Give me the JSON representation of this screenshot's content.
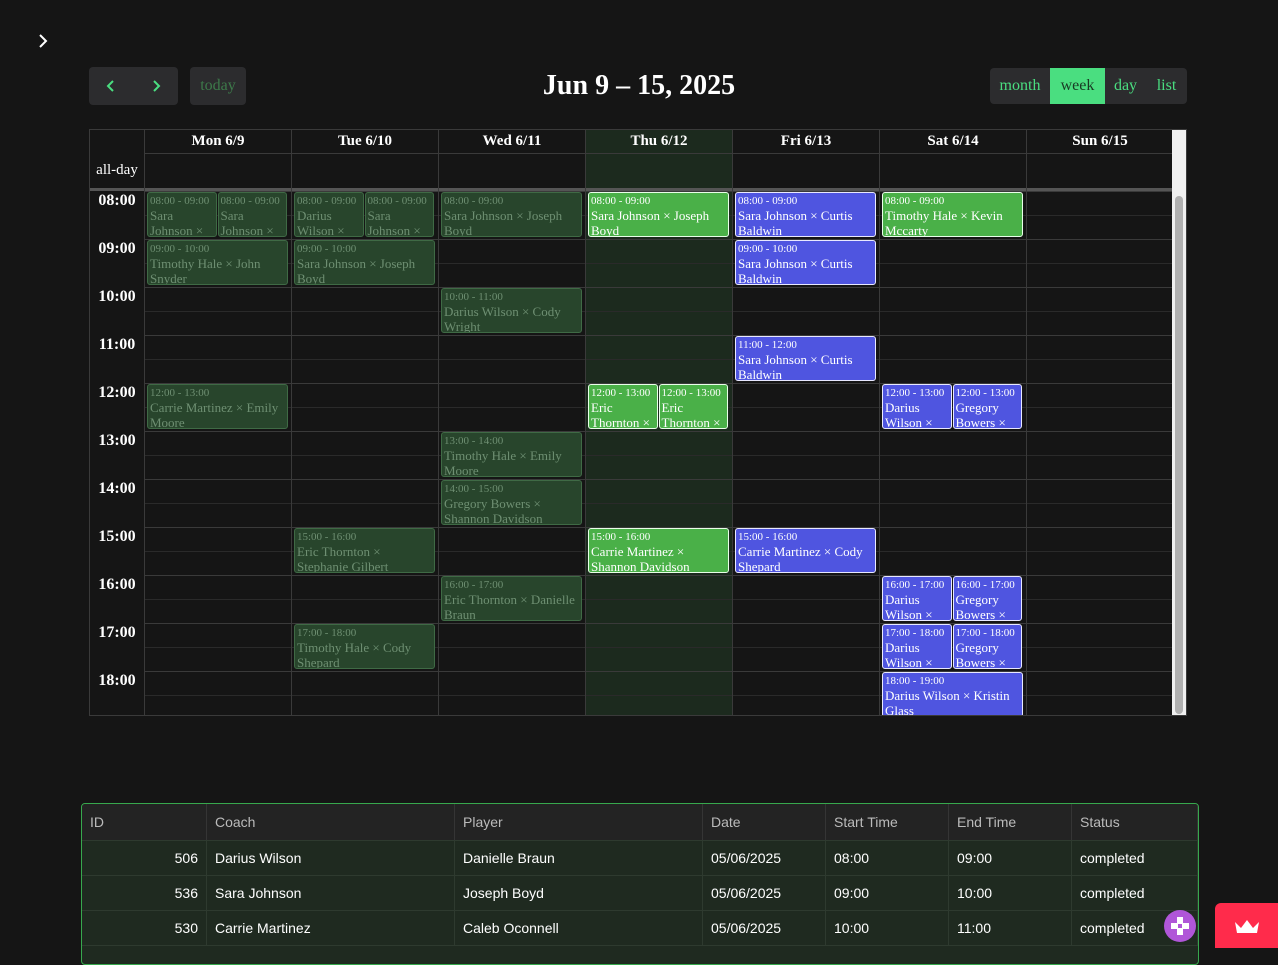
{
  "sidebar": {
    "expand_icon": "chevron-right-icon"
  },
  "toolbar": {
    "prev_icon": "chevron-left-icon",
    "next_icon": "chevron-right-icon",
    "today_label": "today",
    "title": "Jun 9 – 15, 2025",
    "views": [
      "month",
      "week",
      "day",
      "list"
    ],
    "active_view": "week"
  },
  "calendar": {
    "days": [
      "Mon 6/9",
      "Tue 6/10",
      "Wed 6/11",
      "Thu 6/12",
      "Fri 6/13",
      "Sat 6/14",
      "Sun 6/15"
    ],
    "today_index": 3,
    "allday_label": "all-day",
    "hours": [
      "08:00",
      "09:00",
      "10:00",
      "11:00",
      "12:00",
      "13:00",
      "14:00",
      "15:00",
      "16:00",
      "17:00",
      "18:00"
    ],
    "events": [
      {
        "day": 0,
        "start": 8,
        "end": 9,
        "col": 0,
        "cols": 2,
        "style": "past",
        "time": "08:00 - 09:00",
        "title": "Sara Johnson × Darius Wilson"
      },
      {
        "day": 0,
        "start": 8,
        "end": 9,
        "col": 1,
        "cols": 2,
        "style": "past",
        "time": "08:00 - 09:00",
        "title": "Sara Johnson × Kevin Mccarty"
      },
      {
        "day": 0,
        "start": 9,
        "end": 10,
        "col": 0,
        "cols": 1,
        "style": "past",
        "time": "09:00 - 10:00",
        "title": "Timothy Hale × John Snyder"
      },
      {
        "day": 0,
        "start": 12,
        "end": 13,
        "col": 0,
        "cols": 1,
        "style": "past",
        "time": "12:00 - 13:00",
        "title": "Carrie Martinez × Emily Moore"
      },
      {
        "day": 1,
        "start": 8,
        "end": 9,
        "col": 0,
        "cols": 2,
        "style": "past",
        "time": "08:00 - 09:00",
        "title": "Darius Wilson × Kristin Glass"
      },
      {
        "day": 1,
        "start": 8,
        "end": 9,
        "col": 1,
        "cols": 2,
        "style": "past",
        "time": "08:00 - 09:00",
        "title": "Sara Johnson × Joseph Boyd"
      },
      {
        "day": 1,
        "start": 9,
        "end": 10,
        "col": 0,
        "cols": 1,
        "style": "past",
        "time": "09:00 - 10:00",
        "title": "Sara Johnson × Joseph Boyd"
      },
      {
        "day": 1,
        "start": 15,
        "end": 16,
        "col": 0,
        "cols": 1,
        "style": "past",
        "time": "15:00 - 16:00",
        "title": "Eric Thornton × Stephanie Gilbert"
      },
      {
        "day": 1,
        "start": 17,
        "end": 18,
        "col": 0,
        "cols": 1,
        "style": "past",
        "time": "17:00 - 18:00",
        "title": "Timothy Hale × Cody Shepard"
      },
      {
        "day": 2,
        "start": 8,
        "end": 9,
        "col": 0,
        "cols": 1,
        "style": "past",
        "time": "08:00 - 09:00",
        "title": "Sara Johnson × Joseph Boyd"
      },
      {
        "day": 2,
        "start": 10,
        "end": 11,
        "col": 0,
        "cols": 1,
        "style": "past",
        "time": "10:00 - 11:00",
        "title": "Darius Wilson × Cody Wright"
      },
      {
        "day": 2,
        "start": 13,
        "end": 14,
        "col": 0,
        "cols": 1,
        "style": "past",
        "time": "13:00 - 14:00",
        "title": "Timothy Hale × Emily Moore"
      },
      {
        "day": 2,
        "start": 14,
        "end": 15,
        "col": 0,
        "cols": 1,
        "style": "past",
        "time": "14:00 - 15:00",
        "title": "Gregory Bowers × Shannon Davidson"
      },
      {
        "day": 2,
        "start": 16,
        "end": 17,
        "col": 0,
        "cols": 1,
        "style": "past",
        "time": "16:00 - 17:00",
        "title": "Eric Thornton × Danielle Braun"
      },
      {
        "day": 3,
        "start": 8,
        "end": 9,
        "col": 0,
        "cols": 1,
        "style": "green",
        "time": "08:00 - 09:00",
        "title": "Sara Johnson × Joseph Boyd"
      },
      {
        "day": 3,
        "start": 12,
        "end": 13,
        "col": 0,
        "cols": 2,
        "style": "green",
        "time": "12:00 - 13:00",
        "title": "Eric Thornton × Stephanie Gilbert"
      },
      {
        "day": 3,
        "start": 12,
        "end": 13,
        "col": 1,
        "cols": 2,
        "style": "green",
        "time": "12:00 - 13:00",
        "title": "Eric Thornton × Danielle Braun"
      },
      {
        "day": 3,
        "start": 15,
        "end": 16,
        "col": 0,
        "cols": 1,
        "style": "green",
        "time": "15:00 - 16:00",
        "title": "Carrie Martinez × Shannon Davidson"
      },
      {
        "day": 4,
        "start": 8,
        "end": 9,
        "col": 0,
        "cols": 1,
        "style": "blue",
        "time": "08:00 - 09:00",
        "title": "Sara Johnson × Curtis Baldwin"
      },
      {
        "day": 4,
        "start": 9,
        "end": 10,
        "col": 0,
        "cols": 1,
        "style": "blue",
        "time": "09:00 - 10:00",
        "title": "Sara Johnson × Curtis Baldwin"
      },
      {
        "day": 4,
        "start": 11,
        "end": 12,
        "col": 0,
        "cols": 1,
        "style": "blue",
        "time": "11:00 - 12:00",
        "title": "Sara Johnson × Curtis Baldwin"
      },
      {
        "day": 4,
        "start": 15,
        "end": 16,
        "col": 0,
        "cols": 1,
        "style": "blue",
        "time": "15:00 - 16:00",
        "title": "Carrie Martinez × Cody Shepard"
      },
      {
        "day": 5,
        "start": 8,
        "end": 9,
        "col": 0,
        "cols": 1,
        "style": "green",
        "time": "08:00 - 09:00",
        "title": "Timothy Hale × Kevin Mccarty"
      },
      {
        "day": 5,
        "start": 12,
        "end": 13,
        "col": 0,
        "cols": 2,
        "style": "blue",
        "time": "12:00 - 13:00",
        "title": "Darius Wilson × Kristin Glass"
      },
      {
        "day": 5,
        "start": 12,
        "end": 13,
        "col": 1,
        "cols": 2,
        "style": "blue",
        "time": "12:00 - 13:00",
        "title": "Gregory Bowers × Caleb Oconnell"
      },
      {
        "day": 5,
        "start": 16,
        "end": 17,
        "col": 0,
        "cols": 2,
        "style": "blue",
        "time": "16:00 - 17:00",
        "title": "Darius Wilson × Kristin Glass"
      },
      {
        "day": 5,
        "start": 16,
        "end": 17,
        "col": 1,
        "cols": 2,
        "style": "blue",
        "time": "16:00 - 17:00",
        "title": "Gregory Bowers × Caleb Oconnell"
      },
      {
        "day": 5,
        "start": 17,
        "end": 18,
        "col": 0,
        "cols": 2,
        "style": "blue",
        "time": "17:00 - 18:00",
        "title": "Darius Wilson × Kristin Glass"
      },
      {
        "day": 5,
        "start": 17,
        "end": 18,
        "col": 1,
        "cols": 2,
        "style": "blue",
        "time": "17:00 - 18:00",
        "title": "Gregory Bowers × Caleb Oconnell"
      },
      {
        "day": 5,
        "start": 18,
        "end": 19,
        "col": 0,
        "cols": 1,
        "style": "blue",
        "time": "18:00 - 19:00",
        "title": "Darius Wilson × Kristin Glass"
      }
    ]
  },
  "table": {
    "columns": [
      "ID",
      "Coach",
      "Player",
      "Date",
      "Start Time",
      "End Time",
      "Status"
    ],
    "rows": [
      [
        "506",
        "Darius Wilson",
        "Danielle Braun",
        "05/06/2025",
        "08:00",
        "09:00",
        "completed"
      ],
      [
        "536",
        "Sara Johnson",
        "Joseph Boyd",
        "05/06/2025",
        "09:00",
        "10:00",
        "completed"
      ],
      [
        "530",
        "Carrie Martinez",
        "Caleb Oconnell",
        "05/06/2025",
        "10:00",
        "11:00",
        "completed"
      ]
    ]
  },
  "colors": {
    "accent": "#4ade80",
    "event_green": "#4ab048",
    "event_blue": "#4f55e0",
    "event_past": "#28452c",
    "brand": "#ff2b4b"
  },
  "widgets": {
    "avatar_icon": "avatar-icon",
    "brand_icon": "crown-icon"
  }
}
